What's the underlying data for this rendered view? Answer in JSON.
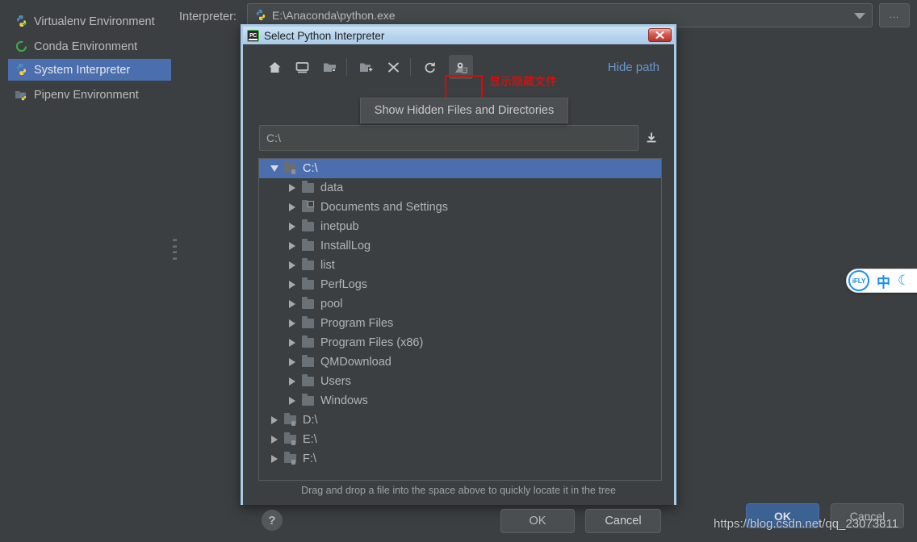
{
  "sidebar": {
    "items": [
      {
        "label": "Virtualenv Environment",
        "icon": "python-venv-icon",
        "selected": false
      },
      {
        "label": "Conda Environment",
        "icon": "conda-circle-icon",
        "selected": false
      },
      {
        "label": "System Interpreter",
        "icon": "python-icon",
        "selected": true
      },
      {
        "label": "Pipenv Environment",
        "icon": "pipenv-folder-icon",
        "selected": false
      }
    ]
  },
  "background": {
    "interpreter_label": "Interpreter:",
    "interpreter_value": "E:\\Anaconda\\python.exe",
    "browse_button_label": "...",
    "combo_arrow_icon": "chevron-down-icon",
    "ok_label": "OK",
    "cancel_label": "Cancel",
    "watermark": "https://blog.csdn.net/qq_23073811"
  },
  "ime_widget": {
    "logo_text": "iFLY",
    "mode": "中",
    "moon_icon": "☾"
  },
  "dialog": {
    "title": "Select Python Interpreter",
    "app_icon": "pycharm-icon",
    "close_icon": "✖",
    "toolbar": {
      "buttons": [
        {
          "name": "home-icon",
          "tooltip": "Home"
        },
        {
          "name": "desktop-icon",
          "tooltip": "Desktop"
        },
        {
          "name": "project-folder-icon",
          "tooltip": "Project Directory"
        },
        {
          "name": "new-folder-icon",
          "tooltip": "New Folder"
        },
        {
          "name": "delete-icon",
          "tooltip": "Delete"
        },
        {
          "name": "refresh-icon",
          "tooltip": "Refresh"
        },
        {
          "name": "show-hidden-icon",
          "tooltip": "Show Hidden Files and Directories"
        }
      ],
      "hide_path_label": "Hide path",
      "tooltip_text": "Show Hidden Files and Directories",
      "annotation_text": "显示隐藏文件",
      "annotation_color": "#fb0505"
    },
    "path_field": {
      "value": "C:\\",
      "download_icon": "download-icon"
    },
    "tree": [
      {
        "label": "C:\\",
        "indent": 0,
        "expanded": true,
        "selected": true,
        "icon": "drive-icon"
      },
      {
        "label": "data",
        "indent": 1,
        "expanded": false,
        "selected": false,
        "icon": "folder-icon"
      },
      {
        "label": "Documents and Settings",
        "indent": 1,
        "expanded": false,
        "selected": false,
        "icon": "folder-link-icon"
      },
      {
        "label": "inetpub",
        "indent": 1,
        "expanded": false,
        "selected": false,
        "icon": "folder-icon"
      },
      {
        "label": "InstallLog",
        "indent": 1,
        "expanded": false,
        "selected": false,
        "icon": "folder-icon"
      },
      {
        "label": "list",
        "indent": 1,
        "expanded": false,
        "selected": false,
        "icon": "folder-icon"
      },
      {
        "label": "PerfLogs",
        "indent": 1,
        "expanded": false,
        "selected": false,
        "icon": "folder-icon"
      },
      {
        "label": "pool",
        "indent": 1,
        "expanded": false,
        "selected": false,
        "icon": "folder-icon"
      },
      {
        "label": "Program Files",
        "indent": 1,
        "expanded": false,
        "selected": false,
        "icon": "folder-icon"
      },
      {
        "label": "Program Files (x86)",
        "indent": 1,
        "expanded": false,
        "selected": false,
        "icon": "folder-icon"
      },
      {
        "label": "QMDownload",
        "indent": 1,
        "expanded": false,
        "selected": false,
        "icon": "folder-icon"
      },
      {
        "label": "Users",
        "indent": 1,
        "expanded": false,
        "selected": false,
        "icon": "folder-icon"
      },
      {
        "label": "Windows",
        "indent": 1,
        "expanded": false,
        "selected": false,
        "icon": "folder-icon"
      },
      {
        "label": "D:\\",
        "indent": 0,
        "expanded": false,
        "selected": false,
        "icon": "drive-icon"
      },
      {
        "label": "E:\\",
        "indent": 0,
        "expanded": false,
        "selected": false,
        "icon": "drive-icon"
      },
      {
        "label": "F:\\",
        "indent": 0,
        "expanded": false,
        "selected": false,
        "icon": "drive-icon"
      }
    ],
    "drag_hint": "Drag and drop a file into the space above to quickly locate it in the tree",
    "help_label": "?",
    "ok_label": "OK",
    "cancel_label": "Cancel"
  }
}
